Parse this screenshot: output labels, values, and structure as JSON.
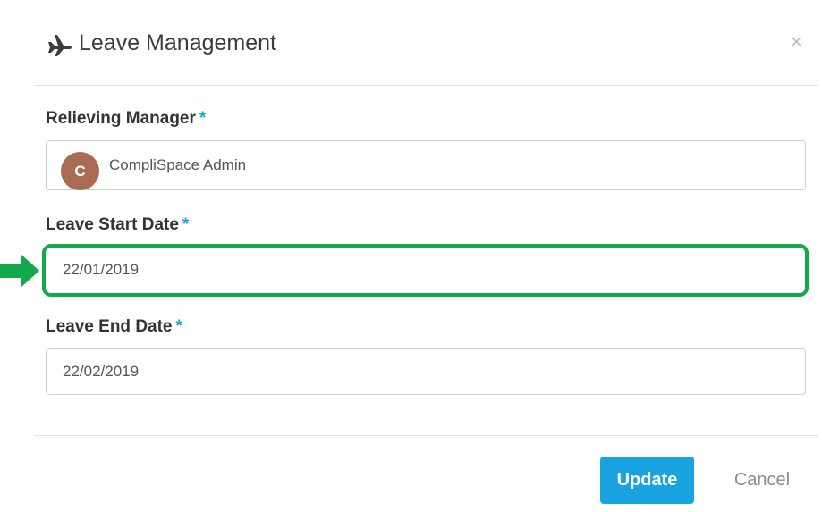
{
  "modal": {
    "title": "Leave Management",
    "close_label": "×"
  },
  "form": {
    "relieving_manager": {
      "label": "Relieving Manager",
      "required_mark": "*",
      "value": "CompliSpace Admin",
      "avatar_initial": "C"
    },
    "leave_start_date": {
      "label": "Leave Start Date",
      "required_mark": "*",
      "value": "22/01/2019"
    },
    "leave_end_date": {
      "label": "Leave End Date",
      "required_mark": "*",
      "value": "22/02/2019"
    }
  },
  "footer": {
    "update_label": "Update",
    "cancel_label": "Cancel"
  },
  "icons": {
    "title_icon": "airplane-icon",
    "close_icon": "close-icon",
    "annotation_arrow": "arrow-right-icon"
  },
  "colors": {
    "accent": "#19a3e0",
    "required": "#1aa3d6",
    "highlight": "#12a94a",
    "avatar": "#a86c52"
  }
}
